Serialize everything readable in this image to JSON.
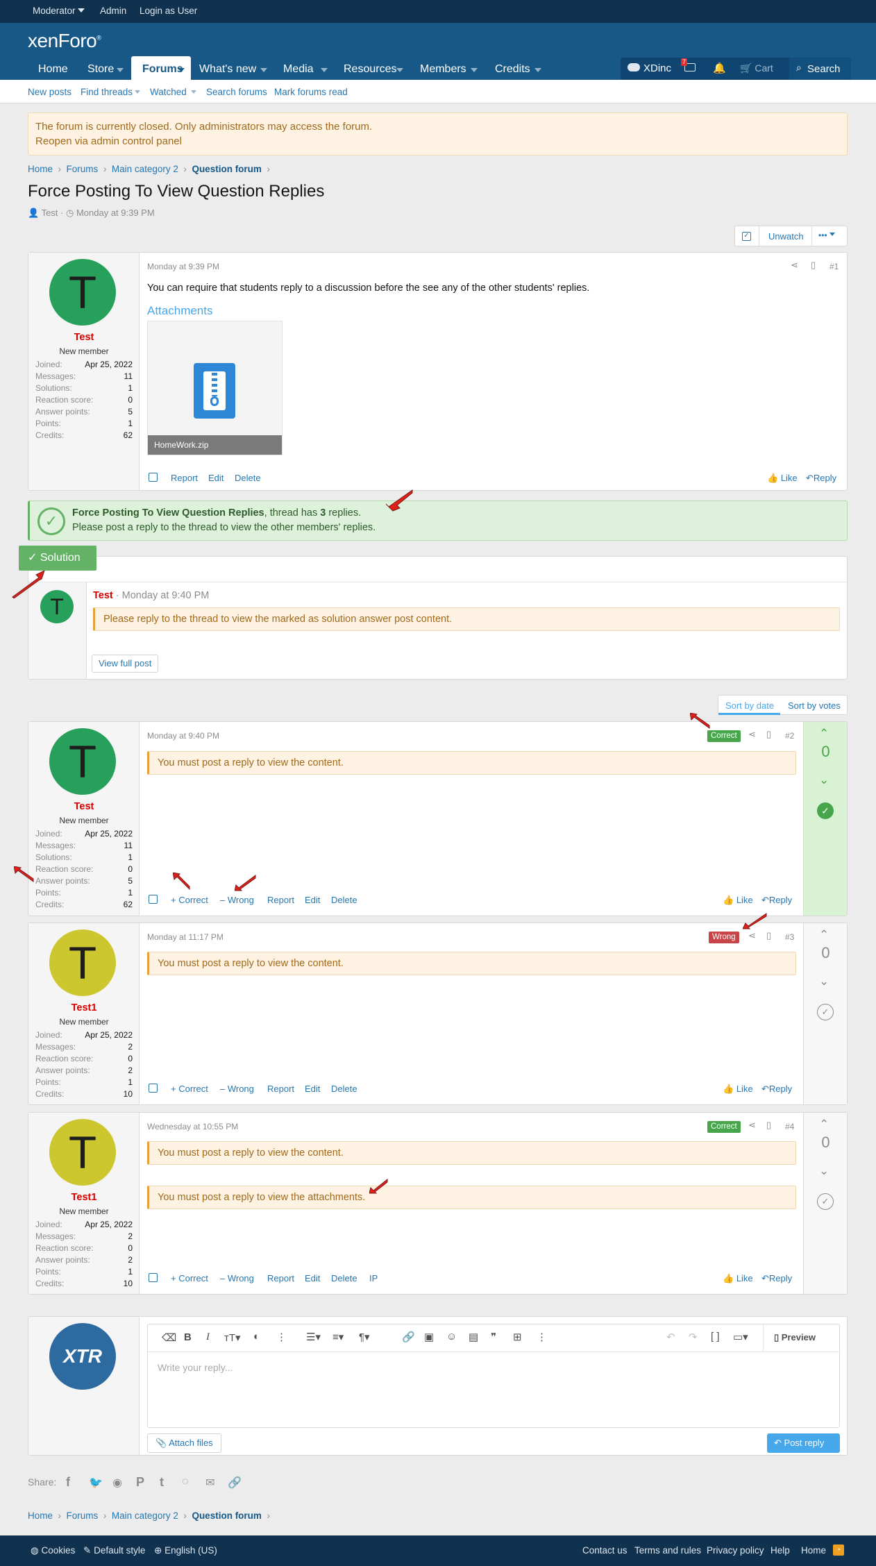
{
  "topbar": {
    "moderator": "Moderator",
    "admin": "Admin",
    "login_as_user": "Login as User"
  },
  "logo": {
    "text": "xenForo"
  },
  "nav": {
    "home": "Home",
    "store": "Store",
    "forums": "Forums",
    "whats_new": "What's new",
    "media": "Media",
    "resources": "Resources",
    "members": "Members",
    "credits": "Credits",
    "xdinc": "XDinc",
    "inbox_count": "7",
    "cart": "Cart",
    "search": "Search"
  },
  "subnav": {
    "new_posts": "New posts",
    "find_threads": "Find threads",
    "watched": "Watched",
    "search_forums": "Search forums",
    "mark_read": "Mark forums read"
  },
  "notice": {
    "line1": "The forum is currently closed. Only administrators may access the forum.",
    "line2": "Reopen via admin control panel"
  },
  "breadcrumb": {
    "home": "Home",
    "forums": "Forums",
    "category": "Main category 2",
    "forum": "Question forum"
  },
  "thread": {
    "title": "Force Posting To View Question Replies",
    "author": "Test",
    "date": "Monday at 9:39 PM",
    "unwatch": "Unwatch",
    "more": "•••"
  },
  "post1": {
    "date": "Monday at 9:39 PM",
    "num": "#1",
    "text": "You can require that students reply to a discussion before the see any of the other students' replies.",
    "attachments_label": "Attachments",
    "file": "HomeWork.zip",
    "report": "Report",
    "edit": "Edit",
    "delete": "Delete",
    "like": "Like",
    "reply": "Reply"
  },
  "user_test": {
    "initial": "T",
    "name": "Test",
    "title": "New member",
    "joined_label": "Joined:",
    "joined": "Apr 25, 2022",
    "messages_label": "Messages:",
    "messages": "11",
    "solutions_label": "Solutions:",
    "solutions": "1",
    "reaction_label": "Reaction score:",
    "reaction": "0",
    "answer_label": "Answer points:",
    "answer": "5",
    "points_label": "Points:",
    "points": "1",
    "credits_label": "Credits:",
    "credits": "62"
  },
  "user_test1": {
    "initial": "T",
    "name": "Test1",
    "title": "New member",
    "joined": "Apr 25, 2022",
    "messages": "2",
    "reaction": "0",
    "answer": "2",
    "points": "1",
    "credits": "10"
  },
  "force_notice": {
    "title": "Force Posting To View Question Replies",
    "mid": ", thread has ",
    "count": "3",
    "end": " replies.",
    "line2": "Please post a reply to the thread to view the other members' replies."
  },
  "solution": {
    "label": "Solution",
    "author": "Test",
    "date": "Monday at 9:40 PM",
    "message": "Please reply to the thread to view the marked as solution answer post content.",
    "view_full": "View full post"
  },
  "sort": {
    "by_date": "Sort by date",
    "by_votes": "Sort by votes"
  },
  "replies": [
    {
      "date": "Monday at 9:40 PM",
      "num": "#2",
      "badge": "Correct",
      "votes": "0",
      "content": "You must post a reply to view the content."
    },
    {
      "date": "Monday at 11:17 PM",
      "num": "#3",
      "badge": "Wrong",
      "votes": "0",
      "content": "You must post a reply to view the content."
    },
    {
      "date": "Wednesday at 10:55 PM",
      "num": "#4",
      "badge": "Correct",
      "votes": "0",
      "content": "You must post a reply to view the content.",
      "content2": "You must post a reply to view the attachments.",
      "ip": "IP"
    }
  ],
  "post_actions": {
    "correct": "+ Correct",
    "wrong": "– Wrong",
    "report": "Report",
    "edit": "Edit",
    "delete": "Delete",
    "like": "Like",
    "reply": "Reply"
  },
  "editor": {
    "placeholder": "Write your reply...",
    "preview": "Preview",
    "attach": "Attach files",
    "post_reply": "Post reply",
    "avatar_text": "XTR"
  },
  "share": {
    "label": "Share:"
  },
  "footer": {
    "cookies": "Cookies",
    "style": "Default style",
    "language": "English (US)",
    "contact": "Contact us",
    "terms": "Terms and rules",
    "privacy": "Privacy policy",
    "help": "Help",
    "home": "Home"
  },
  "colors": {
    "header": "#185886",
    "topbar": "#10324f",
    "link": "#2577b1",
    "correct": "#47a54b",
    "wrong": "#c84448",
    "solution": "#63b265"
  }
}
